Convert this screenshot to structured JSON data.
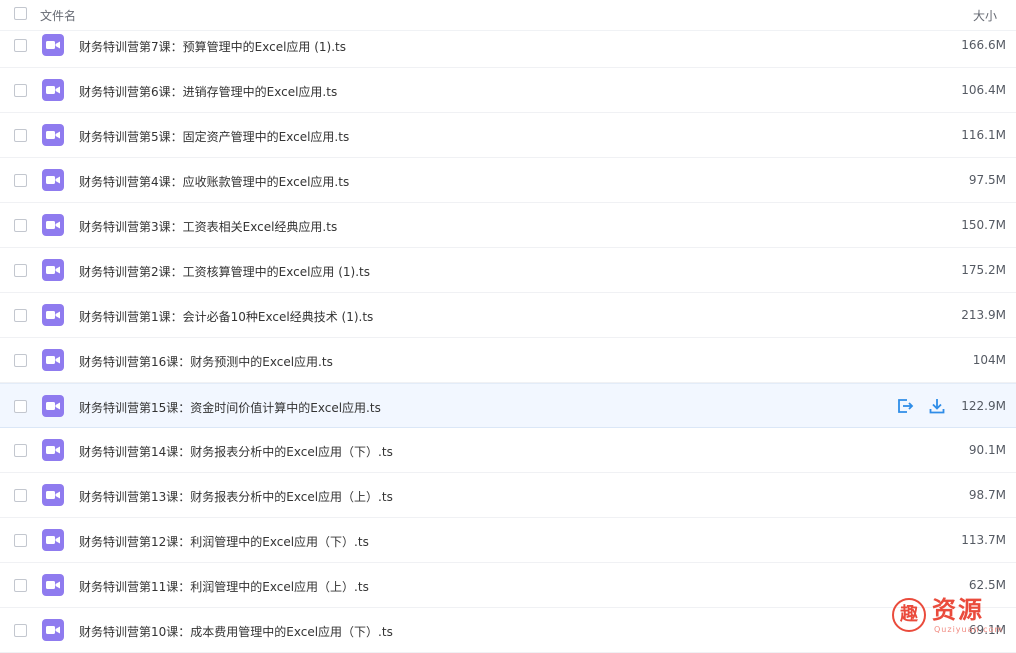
{
  "header": {
    "name_label": "文件名",
    "size_label": "大小"
  },
  "files": [
    {
      "name": "财务特训营第7课：预算管理中的Excel应用 (1).ts",
      "size": "166.6M"
    },
    {
      "name": "财务特训营第6课：进销存管理中的Excel应用.ts",
      "size": "106.4M"
    },
    {
      "name": "财务特训营第5课：固定资产管理中的Excel应用.ts",
      "size": "116.1M"
    },
    {
      "name": "财务特训营第4课：应收账款管理中的Excel应用.ts",
      "size": "97.5M"
    },
    {
      "name": "财务特训营第3课：工资表相关Excel经典应用.ts",
      "size": "150.7M"
    },
    {
      "name": "财务特训营第2课：工资核算管理中的Excel应用 (1).ts",
      "size": "175.2M"
    },
    {
      "name": "财务特训营第1课：会计必备10种Excel经典技术 (1).ts",
      "size": "213.9M"
    },
    {
      "name": "财务特训营第16课：财务预测中的Excel应用.ts",
      "size": "104M"
    },
    {
      "name": "财务特训营第15课：资金时间价值计算中的Excel应用.ts",
      "size": "122.9M"
    },
    {
      "name": "财务特训营第14课：财务报表分析中的Excel应用（下）.ts",
      "size": "90.1M"
    },
    {
      "name": "财务特训营第13课：财务报表分析中的Excel应用（上）.ts",
      "size": "98.7M"
    },
    {
      "name": "财务特训营第12课：利润管理中的Excel应用（下）.ts",
      "size": "113.7M"
    },
    {
      "name": "财务特训营第11课：利润管理中的Excel应用（上）.ts",
      "size": "62.5M"
    },
    {
      "name": "财务特训营第10课：成本费用管理中的Excel应用（下）.ts",
      "size": "69.1M"
    }
  ],
  "active_row_index": 8,
  "file_icon": "video-file-icon",
  "row_actions": [
    "share-icon",
    "download-icon"
  ],
  "colors": {
    "accent": "#2f8de8",
    "file_icon": "#8f7bef",
    "active_row": "#f2f7ff",
    "watermark": "#ea4b3c"
  },
  "watermark": {
    "seal": "趣",
    "text": "资源",
    "url": "Quziyuan.com"
  }
}
